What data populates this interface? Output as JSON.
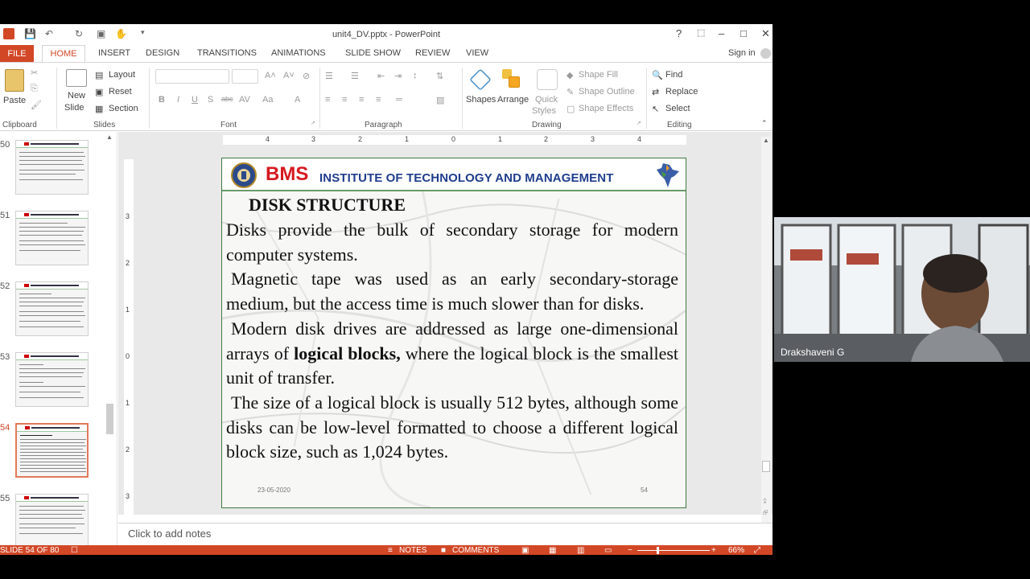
{
  "window": {
    "title": "unit4_DV.pptx - PowerPoint",
    "help_label": "?",
    "minimize_label": "–",
    "restore_label": "□",
    "close_label": "✕",
    "sign_in": "Sign in"
  },
  "tabs": [
    {
      "label": "FILE"
    },
    {
      "label": "HOME"
    },
    {
      "label": "INSERT"
    },
    {
      "label": "DESIGN"
    },
    {
      "label": "TRANSITIONS"
    },
    {
      "label": "ANIMATIONS"
    },
    {
      "label": "SLIDE SHOW"
    },
    {
      "label": "REVIEW"
    },
    {
      "label": "VIEW"
    }
  ],
  "ribbon": {
    "clipboard": {
      "paste": "Paste",
      "group": "Clipboard"
    },
    "slides": {
      "new_slide": "New",
      "new_slide_2": "Slide",
      "layout": "Layout",
      "reset": "Reset",
      "section": "Section",
      "group": "Slides"
    },
    "font": {
      "bold": "B",
      "italic": "I",
      "underline": "U",
      "shadow": "S",
      "strike": "abc",
      "group": "Font"
    },
    "paragraph": {
      "group": "Paragraph"
    },
    "drawing": {
      "shapes": "Shapes",
      "arrange": "Arrange",
      "quick": "Quick",
      "styles": "Styles",
      "shape_fill": "Shape Fill",
      "shape_outline": "Shape Outline",
      "shape_effects": "Shape Effects",
      "group": "Drawing"
    },
    "editing": {
      "find": "Find",
      "replace": "Replace",
      "select": "Select",
      "group": "Editing"
    }
  },
  "thumbnails": [
    {
      "num": "50",
      "selected": false
    },
    {
      "num": "51",
      "selected": false
    },
    {
      "num": "52",
      "selected": false
    },
    {
      "num": "53",
      "selected": false
    },
    {
      "num": "54",
      "selected": true
    },
    {
      "num": "55",
      "selected": false
    }
  ],
  "ruler": {
    "horizontal": [
      "4",
      "3",
      "2",
      "1",
      "0",
      "1",
      "2",
      "3",
      "4"
    ],
    "vertical": [
      "3",
      "2",
      "1",
      "0",
      "1",
      "2",
      "3"
    ]
  },
  "slide": {
    "header_logo_text": "BMS",
    "header_institute": "INSTITUTE OF TECHNOLOGY AND MANAGEMENT",
    "title": "DISK STRUCTURE",
    "para1": "Disks provide the bulk of secondary storage for modern computer systems.",
    "para2": "Magnetic tape was used as an early secondary-storage medium, but the access time is much slower than for disks.",
    "para3_a": "Modern disk drives are addressed as large one-dimensional arrays of ",
    "para3_bold": "logical blocks,",
    "para3_b": " where the logical block is the smallest unit of transfer.",
    "para4": "The size of a logical block is usually 512 bytes, although some disks can be low-level formatted to choose a different logical block size, such as 1,024 bytes.",
    "date": "23-05-2020",
    "page": "54"
  },
  "notes_placeholder": "Click to add notes",
  "status": {
    "slide_counter": "SLIDE 54 OF 80",
    "notes": "NOTES",
    "comments": "COMMENTS",
    "zoom": "66%"
  },
  "video": {
    "participant_name": "Drakshaveni G"
  },
  "colors": {
    "accent": "#d24726",
    "bms_red": "#d71920",
    "institute_blue": "#1f3d8c"
  }
}
